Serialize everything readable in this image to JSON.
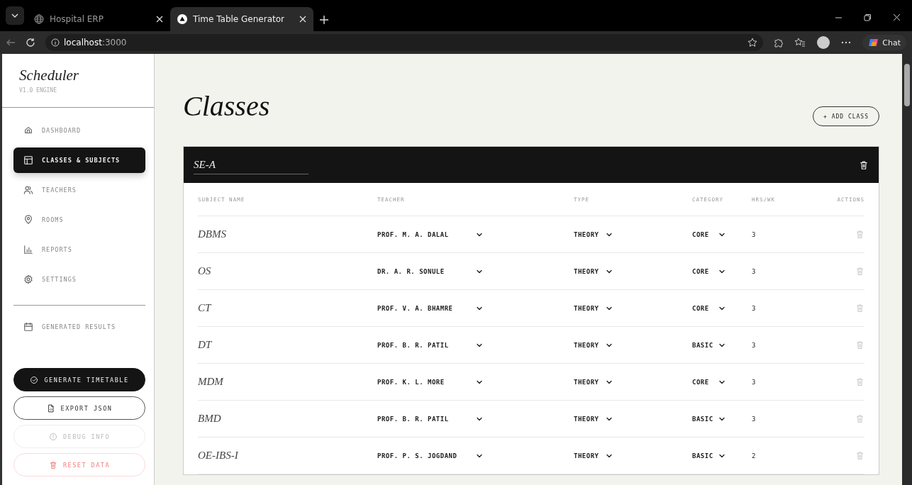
{
  "browser": {
    "tabs": [
      {
        "title": "Hospital ERP",
        "selected": false
      },
      {
        "title": "Time Table Generator",
        "selected": true
      }
    ],
    "url_host": "localhost",
    "url_port": ":3000",
    "chat_label": "Chat"
  },
  "sidebar": {
    "brand": "Scheduler",
    "version": "V1.0 ENGINE",
    "items": [
      {
        "label": "DASHBOARD",
        "selected": false
      },
      {
        "label": "CLASSES & SUBJECTS",
        "selected": true
      },
      {
        "label": "TEACHERS",
        "selected": false
      },
      {
        "label": "ROOMS",
        "selected": false
      },
      {
        "label": "REPORTS",
        "selected": false
      },
      {
        "label": "SETTINGS",
        "selected": false
      }
    ],
    "secondary_items": [
      {
        "label": "GENERATED RESULTS",
        "selected": false
      }
    ],
    "buttons": [
      {
        "label": "GENERATE TIMETABLE",
        "kind": "primary"
      },
      {
        "label": "EXPORT JSON",
        "kind": "outline"
      },
      {
        "label": "DEBUG INFO",
        "kind": "muted"
      },
      {
        "label": "RESET DATA",
        "kind": "danger"
      }
    ]
  },
  "page": {
    "title": "Classes",
    "add_button": "+ ADD CLASS"
  },
  "class_card": {
    "name": "SE-A",
    "columns": [
      "SUBJECT NAME",
      "TEACHER",
      "TYPE",
      "CATEGORY",
      "HRS/WK",
      "ACTIONS"
    ],
    "rows": [
      {
        "subject": "DBMS",
        "teacher": "PROF. M. A. DALAL",
        "type": "THEORY",
        "category": "CORE",
        "hours": "3"
      },
      {
        "subject": "OS",
        "teacher": "DR. A. R. SONULE",
        "type": "THEORY",
        "category": "CORE",
        "hours": "3"
      },
      {
        "subject": "CT",
        "teacher": "PROF. V. A. BHAMRE",
        "type": "THEORY",
        "category": "CORE",
        "hours": "3"
      },
      {
        "subject": "DT",
        "teacher": "PROF. B. R. PATIL",
        "type": "THEORY",
        "category": "BASIC",
        "hours": "3"
      },
      {
        "subject": "MDM",
        "teacher": "PROF. K. L. MORE",
        "type": "THEORY",
        "category": "CORE",
        "hours": "3"
      },
      {
        "subject": "BMD",
        "teacher": "PROF. B. R. PATIL",
        "type": "THEORY",
        "category": "BASIC",
        "hours": "3"
      },
      {
        "subject": "OE-IBS-I",
        "teacher": "PROF. P. S. JOGDAND",
        "type": "THEORY",
        "category": "BASIC",
        "hours": "2"
      }
    ]
  }
}
